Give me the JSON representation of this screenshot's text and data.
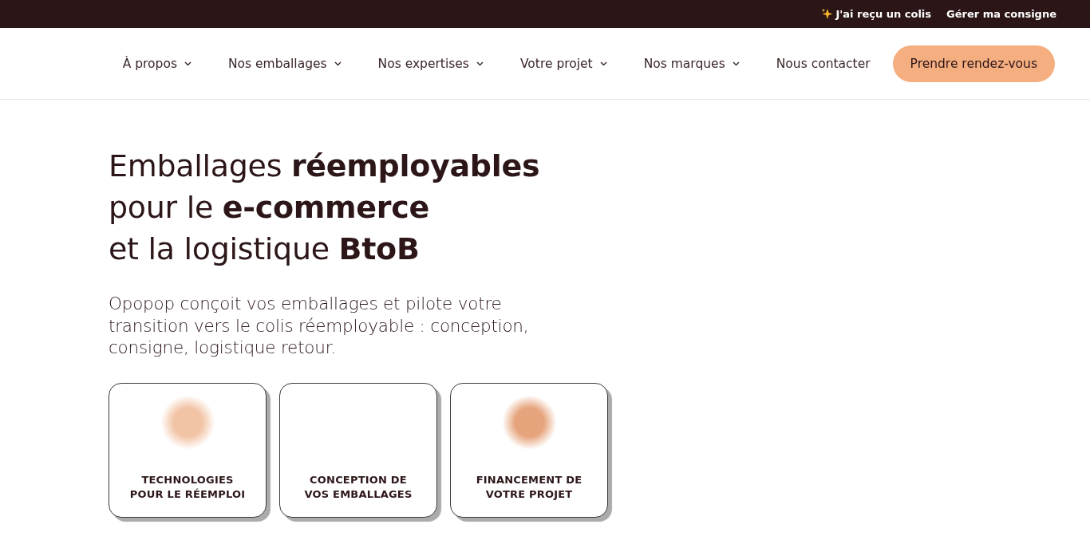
{
  "top_bar": {
    "links": [
      {
        "label": "J'ai reçu un colis",
        "kind": "featured"
      },
      {
        "label": "Gérer ma consigne",
        "kind": "plain"
      }
    ]
  },
  "nav": {
    "items": [
      {
        "label": "À propos",
        "kind": "dropdown"
      },
      {
        "label": "Nos emballages",
        "kind": "dropdown"
      },
      {
        "label": "Nos expertises",
        "kind": "dropdown"
      },
      {
        "label": "Votre projet",
        "kind": "dropdown"
      },
      {
        "label": "Nos marques",
        "kind": "dropdown"
      },
      {
        "label": "Nous contacter",
        "kind": "link"
      }
    ],
    "cta": "Prendre rendez-vous"
  },
  "hero": {
    "title_lines": [
      "Emballages **réemployables**",
      "pour le **e-commerce**",
      "et la logistique **BtoB**"
    ],
    "intro": "Opopop conçoit vos emballages et pilote votre transition vers le colis réemployable : conception, consigne, logistique retour.",
    "cards": [
      {
        "label": "TECHNOLOGIES POUR LE RÉEMPLOI",
        "kind": "image",
        "color": "#f2c4a6"
      },
      {
        "label": "CONCEPTION DE VOS EMBALLAGES",
        "kind": "text"
      },
      {
        "label": "FINANCEMENT DE VOTRE PROJET",
        "kind": "image",
        "color": "#e6a47c"
      }
    ]
  }
}
